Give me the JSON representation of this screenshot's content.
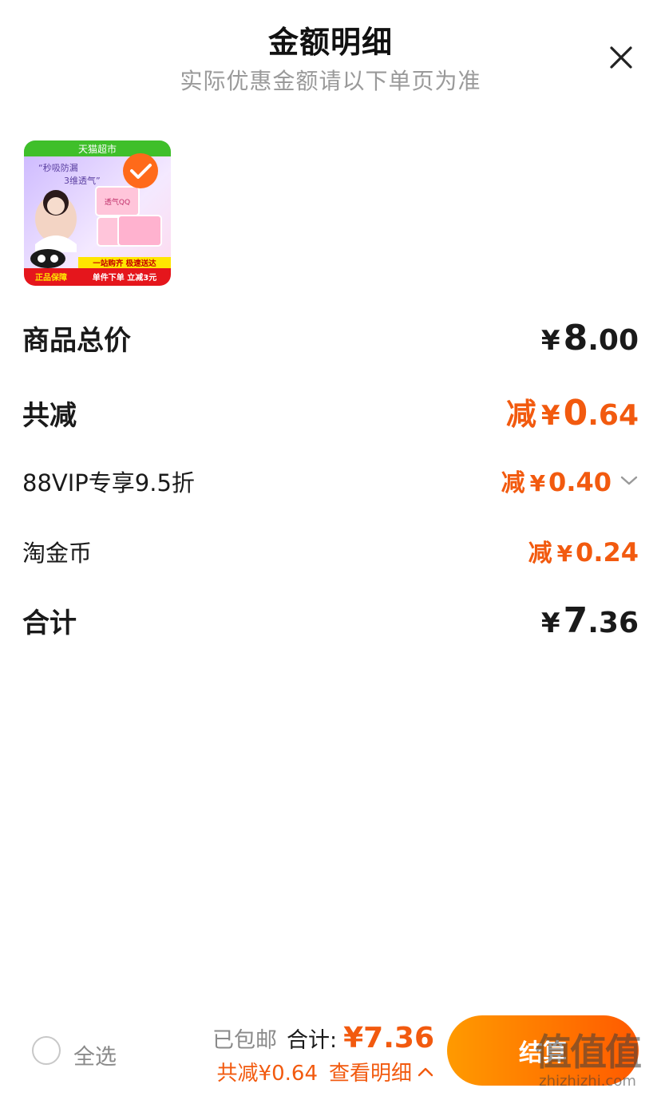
{
  "header": {
    "title": "金额明细",
    "subtitle": "实际优惠金额请以下单页为准"
  },
  "product": {
    "badge_store": "天猫超市",
    "slogan_line1": "“秒吸防漏",
    "slogan_line2": "3维透气”",
    "pack_text": "透气QQ",
    "promo_line1": "一站购齐 极速送达",
    "promo_line2": "单件下单 立减3元",
    "guarantee": "正品保障"
  },
  "rows": {
    "total_price": {
      "label": "商品总价",
      "yen": "¥",
      "int": "8",
      "dec": ".00"
    },
    "total_discount": {
      "label": "共减",
      "prefix": "减",
      "yen": "¥",
      "int": "0",
      "dec": ".64"
    },
    "vip_discount": {
      "label": "88VIP专享9.5折",
      "prefix": "减",
      "yen": "¥",
      "int": "0",
      "dec": ".40"
    },
    "coin_discount": {
      "label": "淘金币",
      "prefix": "减",
      "yen": "¥",
      "int": "0",
      "dec": ".24"
    },
    "sum": {
      "label": "合计",
      "yen": "¥",
      "int": "7",
      "dec": ".36"
    }
  },
  "bottom_bar": {
    "select_all": "全选",
    "free_shipping": "已包邮",
    "total_label": "合计:",
    "total_amount": "¥7.36",
    "discount_text": "共减¥0.64",
    "view_detail": "查看明细",
    "checkout": "结算"
  },
  "watermark": {
    "cn": "值值值",
    "en": "zhizhizhi.com"
  },
  "colors": {
    "accent": "#f25a0f",
    "checkout_start": "#ff9a00",
    "checkout_end": "#ff5a00"
  }
}
